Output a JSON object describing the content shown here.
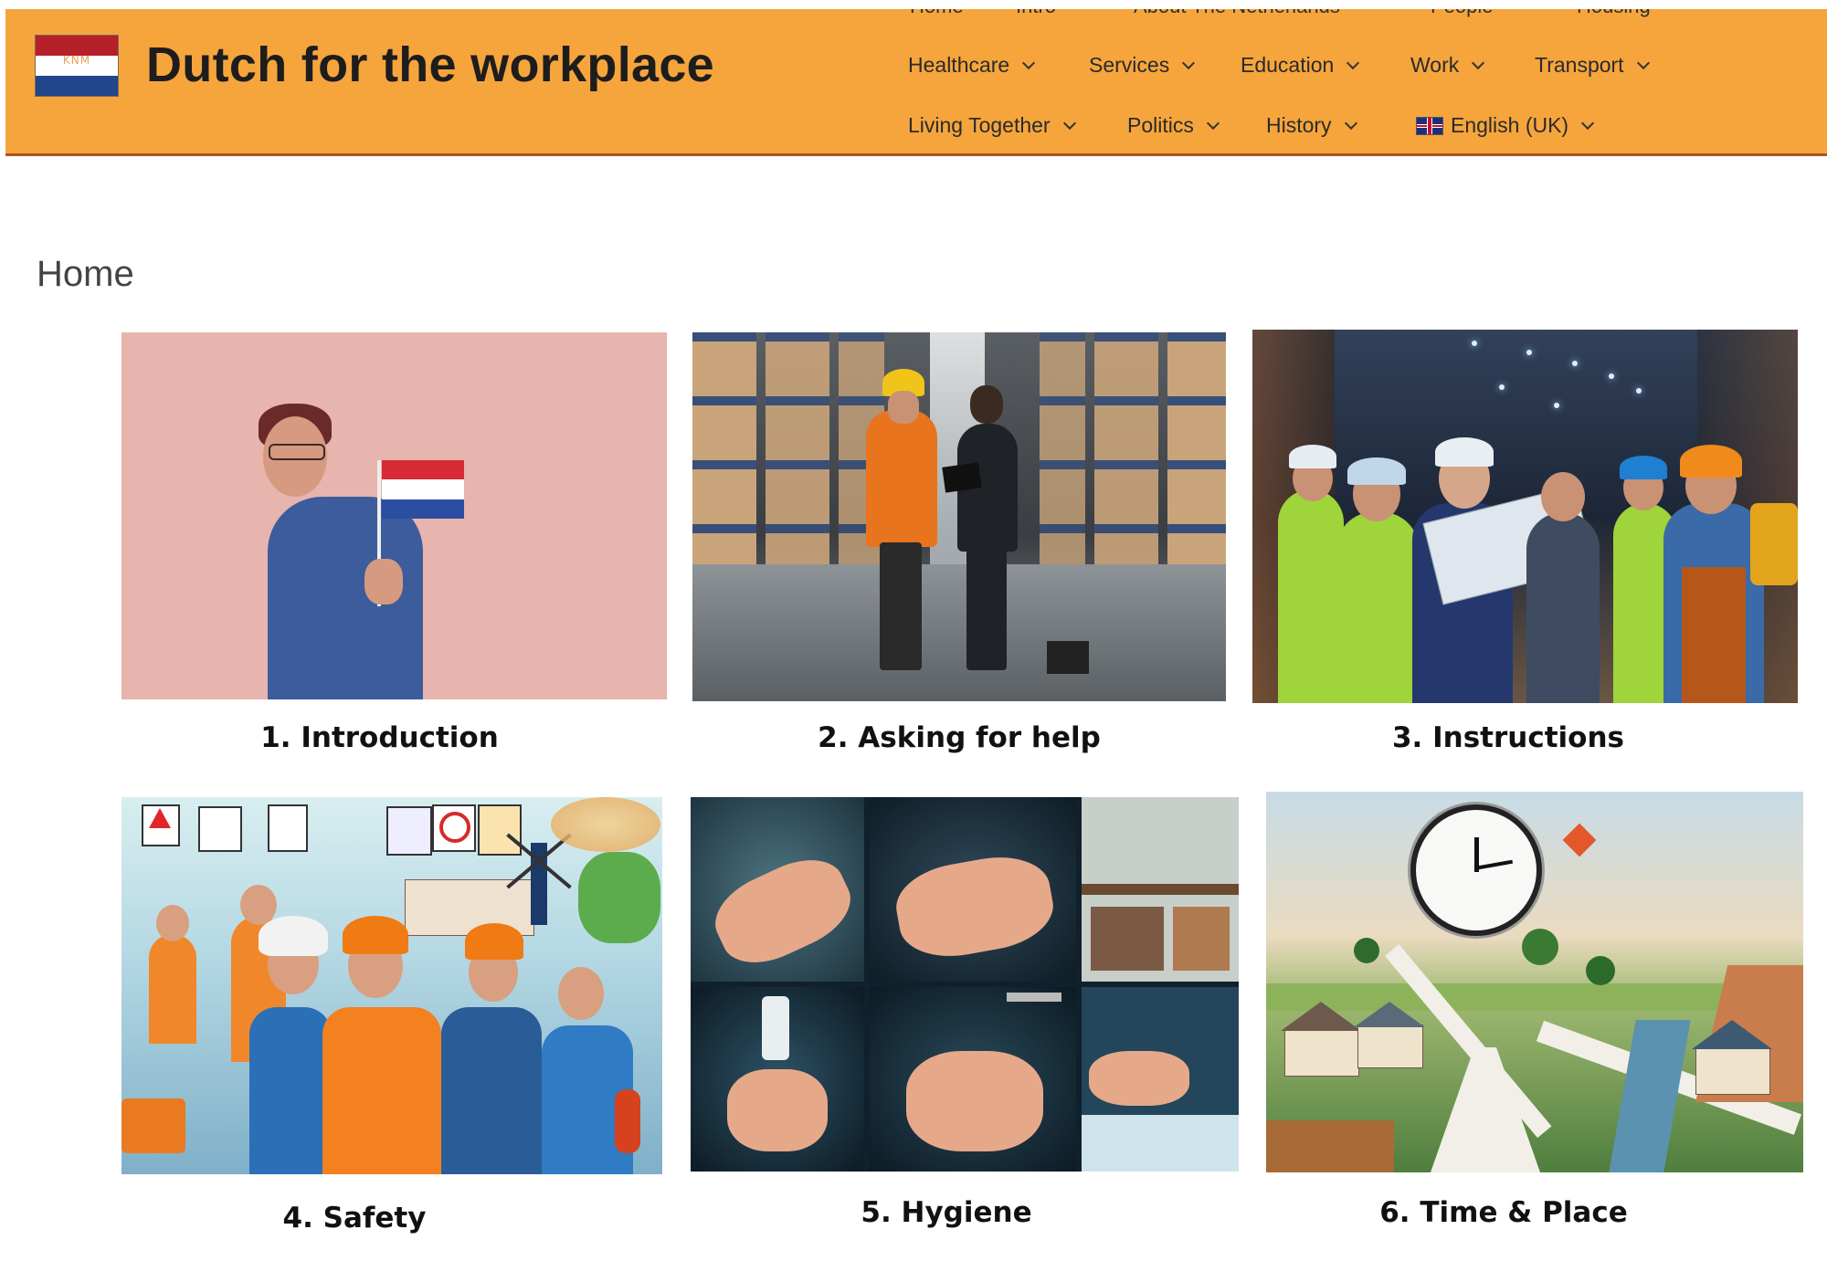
{
  "header": {
    "logo_text": "KNM",
    "title": "Dutch for the workplace",
    "nav_top_partial": [
      "Home",
      "Intro",
      "About The Netherlands",
      "People",
      "Housing"
    ],
    "nav_row1": [
      "Healthcare",
      "Services",
      "Education",
      "Work",
      "Transport"
    ],
    "nav_row2": [
      "Living Together",
      "Politics",
      "History",
      "English (UK)"
    ]
  },
  "page": {
    "heading": "Home"
  },
  "tiles": [
    {
      "caption": "1. Introduction"
    },
    {
      "caption": "2. Asking for help"
    },
    {
      "caption": "3. Instructions"
    },
    {
      "caption": "4. Safety"
    },
    {
      "caption": "5. Hygiene"
    },
    {
      "caption": "6. Time & Place"
    }
  ],
  "colors": {
    "header_bg": "#f6a53c",
    "header_border": "#b0521f",
    "flag_red": "#b5202a",
    "flag_white": "#ffffff",
    "flag_blue": "#21468b"
  }
}
